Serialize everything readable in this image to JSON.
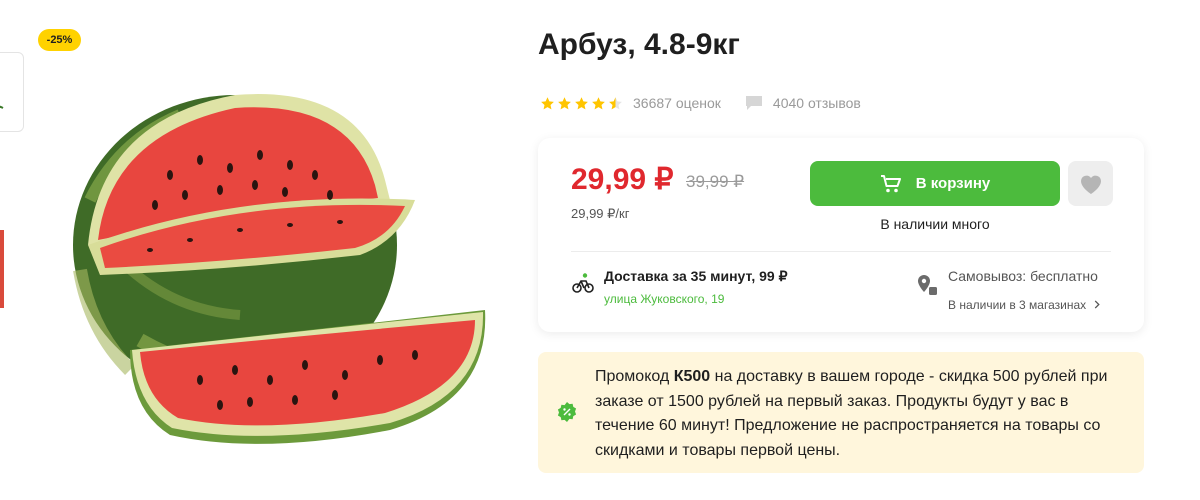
{
  "product": {
    "title": "Арбуз, 4.8-9кг",
    "discount_badge": "-25%",
    "rating": {
      "stars": 4.5,
      "max_stars": 5,
      "ratings_count": "36687 оценок",
      "reviews_count": "4040 отзывов"
    },
    "price": {
      "current": "29,99 ₽",
      "old": "39,99 ₽",
      "per_unit": "29,99 ₽/кг"
    },
    "cart_button_label": "В корзину",
    "stock_status": "В наличии много"
  },
  "delivery": {
    "title": "Доставка за 35 минут, 99 ₽",
    "address": "улица Жуковского, 19"
  },
  "pickup": {
    "title": "Самовывоз: бесплатно",
    "stores": "В наличии в 3 магазинах"
  },
  "promo": {
    "text_before": "Промокод ",
    "code": "К500",
    "text_after": " на доставку в вашем городе - скидка 500 рублей при заказе от 1500 рублей на первый заказ. Продукты будут у вас в течение 60 минут! Предложение не распространяется на товары со скидками и товары первой цены."
  },
  "colors": {
    "accent_green": "#4cbb3d",
    "price_red": "#e0282e",
    "badge_yellow": "#ffd200",
    "star_yellow": "#ffc500",
    "promo_bg": "#fff6dc"
  },
  "icons": {
    "cart": "cart-icon",
    "favorite": "heart-icon",
    "delivery": "courier-bike-icon",
    "pickup": "pickup-location-icon",
    "reviews": "comment-icon",
    "promo": "percent-badge-icon",
    "stores_arrow": "chevron-right-icon"
  }
}
